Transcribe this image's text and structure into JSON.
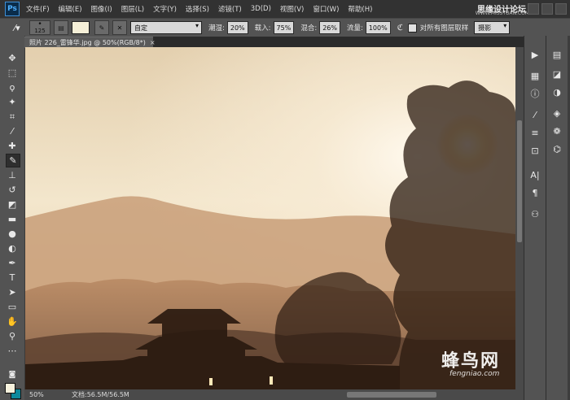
{
  "app": {
    "logo": "Ps",
    "menu": [
      "文件(F)",
      "编辑(E)",
      "图像(I)",
      "图层(L)",
      "文字(Y)",
      "选择(S)",
      "滤镜(T)",
      "3D(D)",
      "视图(V)",
      "窗口(W)",
      "帮助(H)"
    ],
    "watermark_title": "思缘设计论坛",
    "watermark_url": "WWW.MISSYUAN.COM"
  },
  "options": {
    "brush_size": "125",
    "preset": "自定",
    "opacity_label": "潮湿:",
    "opacity_value": "20%",
    "load_label": "载入:",
    "load_value": "75%",
    "mix_label": "混合:",
    "mix_value": "26%",
    "flow_label": "流量:",
    "flow_value": "100%",
    "sample_all_label": "对所有图层取样",
    "workspace": "摄影"
  },
  "document": {
    "tab_title": "照片 226_雷锋华.jpg @ 50%(RGB/8*)",
    "tab_close": "×",
    "zoom": "50%",
    "doc_size": "文档:56.5M/56.5M"
  },
  "colors": {
    "foreground": "#f7f2dd",
    "background": "#0e8a9c"
  },
  "overlay": {
    "brand": "蜂鸟网",
    "brand_url": "fengniao.com"
  }
}
